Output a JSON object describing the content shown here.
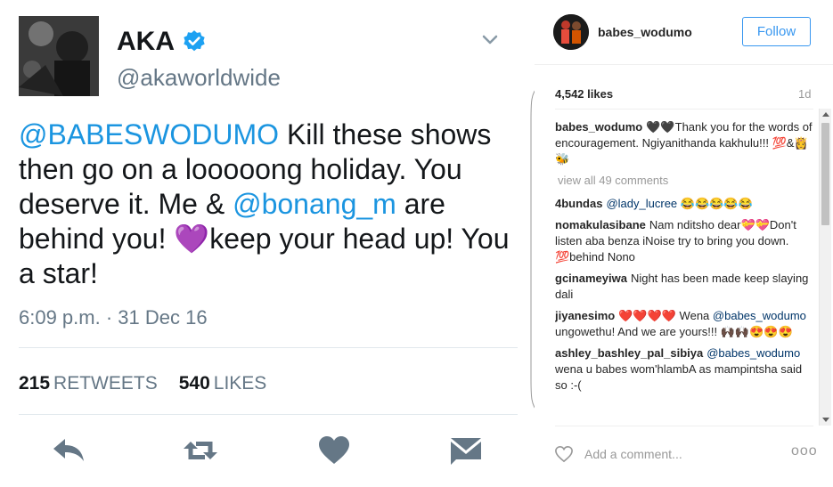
{
  "tweet": {
    "display_name": "AKA",
    "handle": "@akaworldwide",
    "text_parts": {
      "mention1": "@BABESWODUMO",
      "t1": " Kill these shows then go on a looooong holiday. You deserve it. Me & ",
      "mention2": "@bonang_m",
      "t2": " are behind you! ",
      "emoji": "💜",
      "t3": "keep your head up! You a star!"
    },
    "timestamp": "6:09 p.m. · 31 Dec 16",
    "retweets_count": "215",
    "retweets_label": "RETWEETS",
    "likes_count": "540",
    "likes_label": "LIKES",
    "icons": [
      "reply-icon",
      "retweet-icon",
      "like-icon",
      "message-icon",
      "verified-icon",
      "chevron-down-icon"
    ],
    "colors": {
      "link": "#1b95e0",
      "muted": "#657786",
      "verified": "#1da1f2",
      "action": "#657786"
    }
  },
  "instagram": {
    "username": "babes_wodumo",
    "follow_label": "Follow",
    "likes": "4,542 likes",
    "age": "1d",
    "caption_user": "babes_wodumo",
    "caption_text": "🖤🖤Thank you for the words of encouragement. Ngiyanithanda kakhulu!!! 💯&👸🐝",
    "view_all": "view all 49 comments",
    "comments": [
      {
        "user": "4bundas",
        "mention": "@lady_lucree",
        "text": " 😂😂😂😂😂"
      },
      {
        "user": "nomakulasibane",
        "mention": "",
        "text": "Nam nditsho dear💝💝Don't listen aba benza iNoise try to bring you down. 💯behind Nono"
      },
      {
        "user": "gcinameyiwa",
        "mention": "",
        "text": "Night has been made keep slaying dali"
      },
      {
        "user": "jiyanesimo",
        "mention": "@babes_wodumo",
        "text": " ungowethu! And we are yours!!! 🙌🏿🙌🏿😍😍😍",
        "prefix": "❤️❤️❤️❤️ Wena "
      },
      {
        "user": "ashley_bashley_pal_sibiya",
        "mention": "@babes_wodumo",
        "text": " wena u babes wom'hlambA as mampintsha said so :-("
      }
    ],
    "add_comment_placeholder": "Add a comment...",
    "more_label": "ooo",
    "icons": [
      "heart-outline-icon",
      "more-options-icon"
    ],
    "colors": {
      "follow": "#3897f0",
      "text": "#262626",
      "muted": "#999999"
    }
  }
}
